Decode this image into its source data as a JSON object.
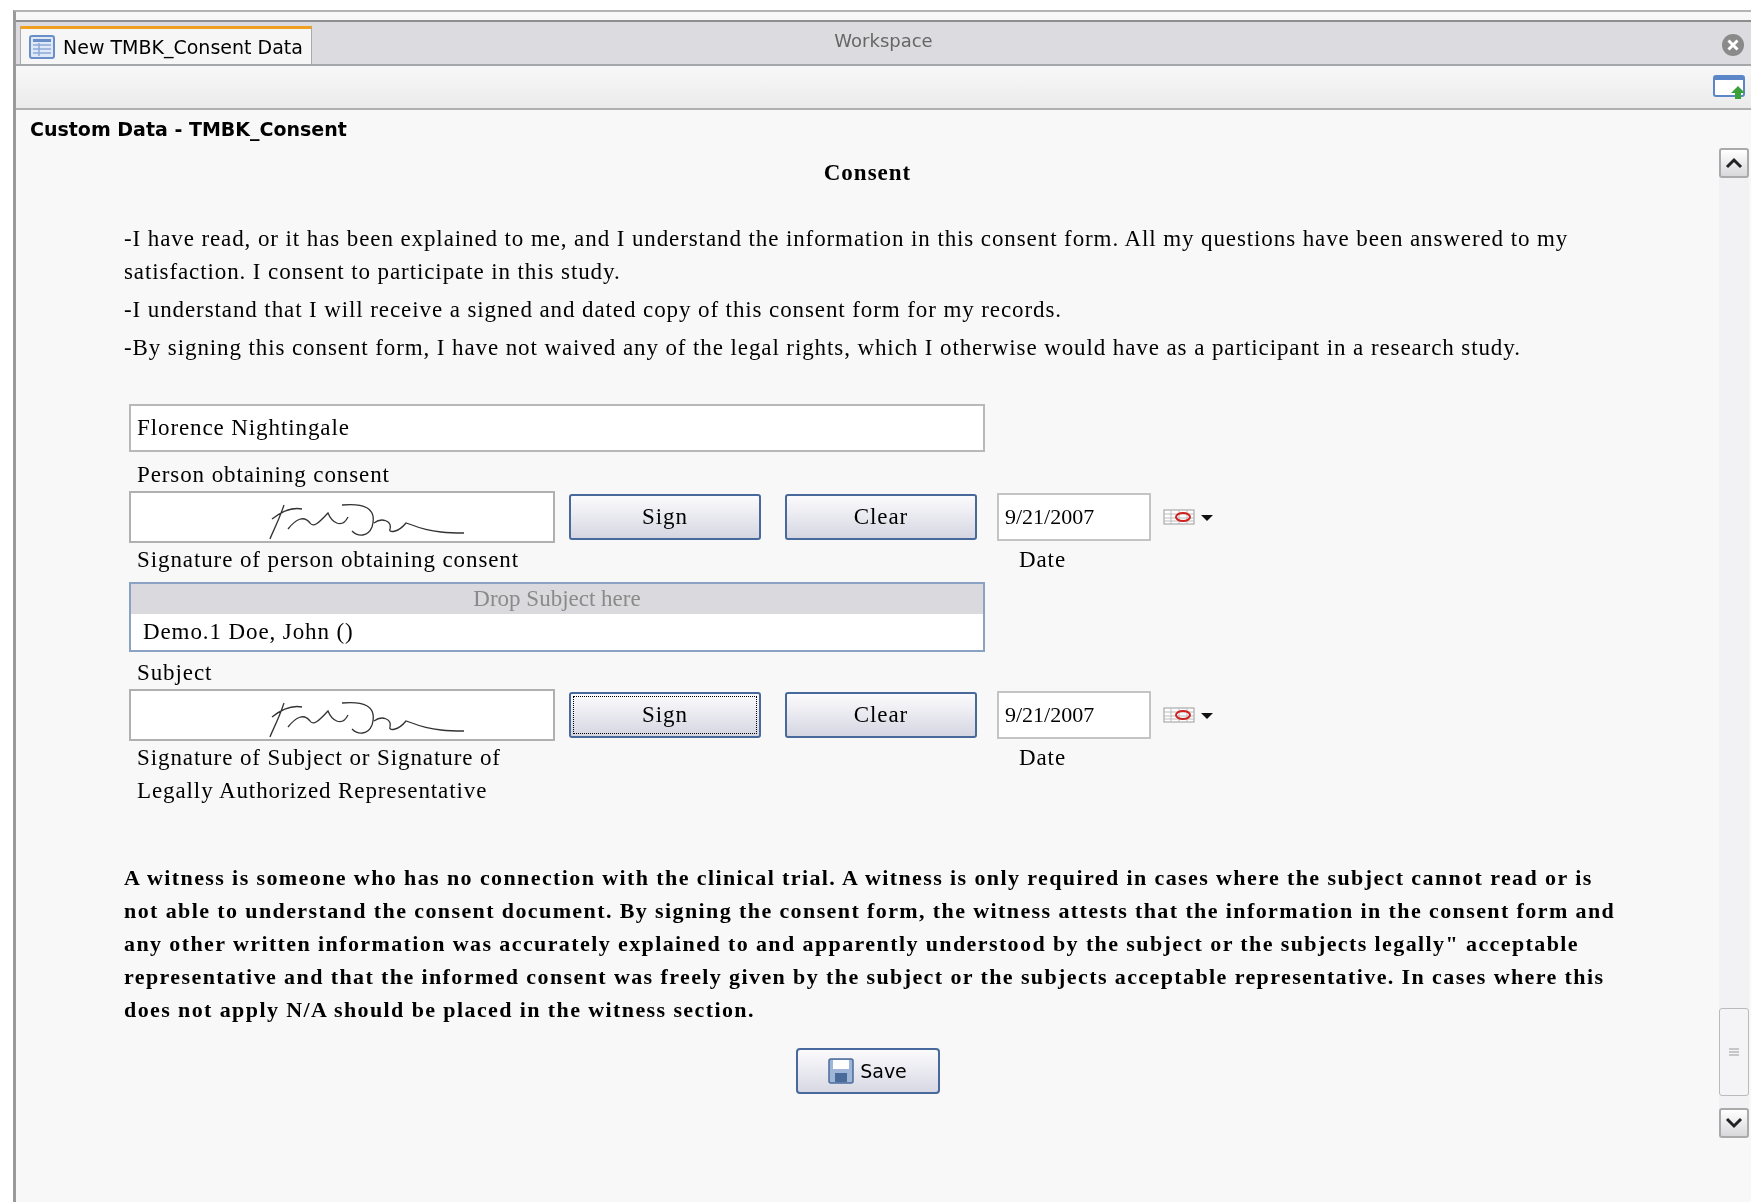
{
  "tabs": [
    {
      "label": "New TMBK_Consent Data",
      "selected": true
    }
  ],
  "workspace_title": "Workspace",
  "section_title": "Custom Data - TMBK_Consent",
  "form": {
    "title": "Consent",
    "statements": [
      "-I have read, or it has been explained to me, and I understand the information in this consent form. All my questions have been answered to my satisfaction. I consent to participate in this study.",
      "-I understand that I will receive a signed and dated copy of this consent form for my records.",
      "-By signing this consent form, I have not waived any of the legal rights, which I otherwise would have as a participant in a research study."
    ],
    "items": [
      {
        "kind": "text_field",
        "value": "Florence Nightingale",
        "label": "Person obtaining consent"
      },
      {
        "kind": "signature",
        "signed": true,
        "sign_button": "Sign",
        "sign_focused": false,
        "clear_button": "Clear",
        "date": "9/21/2007",
        "date_label": "Date",
        "label_lines": [
          "Signature of person obtaining consent"
        ]
      },
      {
        "kind": "subject",
        "drop_hint": "Drop Subject here",
        "value": "Demo.1 Doe, John ()",
        "label": "Subject"
      },
      {
        "kind": "signature",
        "signed": true,
        "sign_button": "Sign",
        "sign_focused": true,
        "clear_button": "Clear",
        "date": "9/21/2007",
        "date_label": "Date",
        "label_lines": [
          "Signature of Subject or Signature of",
          "Legally Authorized Representative"
        ]
      }
    ],
    "witness_note": "A witness is someone who has no connection with the clinical trial. A witness is only required in cases where the subject cannot read or is not able to understand the consent document. By signing the consent form, the witness attests that the information in the consent form and any other written information was accurately explained to and apparently understood by the subject or the subjects legally\" acceptable representative and that the informed consent was freely given by the subject or the subjects acceptable representative. In cases where this does not apply N/A should be placed in the witness section.",
    "save_button": "Save"
  }
}
